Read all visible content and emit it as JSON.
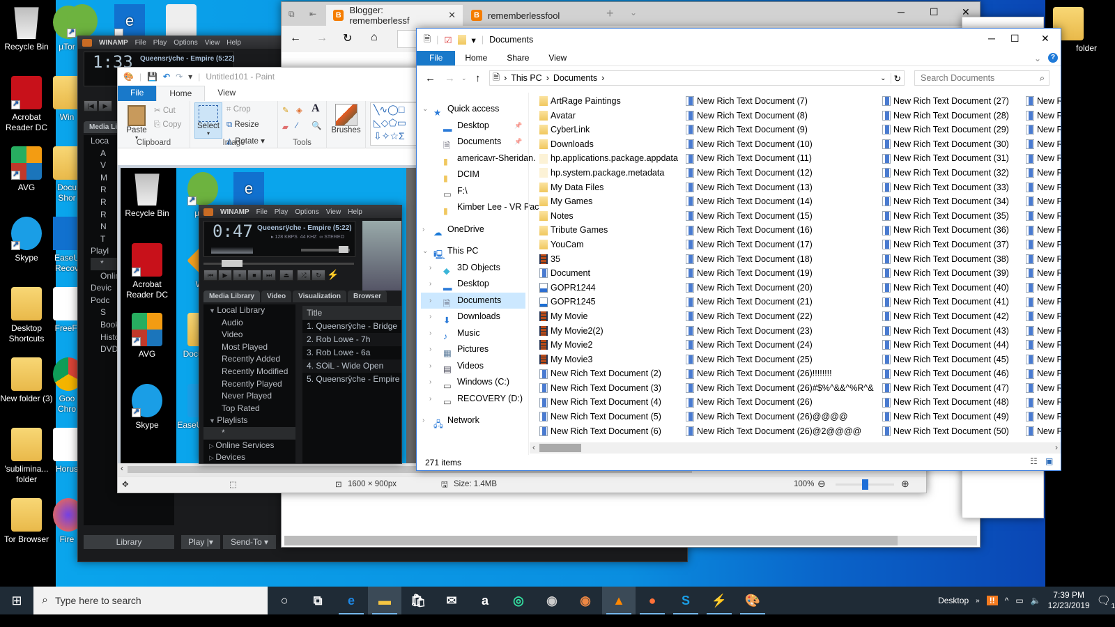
{
  "desktop": {
    "left_icons": [
      {
        "label": "Recycle Bin",
        "icon": "recycle-bin-icon"
      },
      {
        "label": "Acrobat Reader DC",
        "icon": "acrobat-icon"
      },
      {
        "label": "AVG",
        "icon": "avg-icon"
      },
      {
        "label": "Skype",
        "icon": "skype-icon"
      },
      {
        "label": "Desktop Shortcuts",
        "icon": "folder-icon"
      },
      {
        "label": "New folder (3)",
        "icon": "folder-icon"
      },
      {
        "label": "'sublimina... folder",
        "icon": "folder-icon"
      },
      {
        "label": "Tor Browser",
        "icon": "tor-icon"
      }
    ],
    "second_col_icons": [
      {
        "label": "µTor",
        "icon": "utorrent-icon"
      },
      {
        "label": "Win",
        "icon": "winamp-icon"
      },
      {
        "label": "Docu Shor",
        "icon": "folder-icon"
      },
      {
        "label": "EaseU Recov",
        "icon": "easeus-icon"
      },
      {
        "label": "FreeFi",
        "icon": "freefile-icon"
      },
      {
        "label": "Goo Chro",
        "icon": "chrome-icon"
      },
      {
        "label": "Horus",
        "icon": "pdf-icon"
      },
      {
        "label": "Fire",
        "icon": "firefox-icon"
      }
    ],
    "top_icons": [
      {
        "label": "",
        "icon": "edge-icon"
      },
      {
        "label": "",
        "icon": "gradient-icon"
      }
    ],
    "right_icons": [
      {
        "label": "folder",
        "icon": "folder-icon"
      }
    ]
  },
  "winamp_back": {
    "brand": "WINAMP",
    "menu": [
      "File",
      "Play",
      "Options",
      "View",
      "Help"
    ],
    "time": "1:33",
    "song": "Queensrÿche - Empire (5:22)",
    "tab": "Media Lib",
    "tree": [
      "Loca",
      "A",
      "V",
      "M",
      "R",
      "R",
      "R",
      "N",
      "T",
      "Playl",
      "*",
      "Onlin",
      "Devic",
      "Podc",
      "S",
      "Book",
      "Histo",
      "DVD"
    ],
    "footer": {
      "library": "Library",
      "play": "Play",
      "send_to": "Send-To"
    }
  },
  "winamp_front": {
    "brand": "WINAMP",
    "menu": [
      "File",
      "Play",
      "Options",
      "View",
      "Help"
    ],
    "time": "0:47",
    "song": "Queensrÿche - Empire (5:22)",
    "bitrate": "128 KBPS",
    "khz": "44 KHZ",
    "stereo": "STEREO",
    "tabs": [
      "Media Library",
      "Video",
      "Visualization",
      "Browser"
    ],
    "tree": [
      {
        "label": "Local Library",
        "type": "group"
      },
      {
        "label": "Audio",
        "type": "item"
      },
      {
        "label": "Video",
        "type": "item"
      },
      {
        "label": "Most Played",
        "type": "item"
      },
      {
        "label": "Recently Added",
        "type": "item"
      },
      {
        "label": "Recently Modified",
        "type": "item"
      },
      {
        "label": "Recently Played",
        "type": "item"
      },
      {
        "label": "Never Played",
        "type": "item"
      },
      {
        "label": "Top Rated",
        "type": "item"
      },
      {
        "label": "Playlists",
        "type": "group"
      },
      {
        "label": "*",
        "type": "item"
      },
      {
        "label": "Online Services",
        "type": "collapsed"
      },
      {
        "label": "Devices",
        "type": "collapsed"
      }
    ],
    "playlist_header": "Title",
    "playlist": [
      "1. Queensrÿche - Bridge",
      "2. Rob Lowe - 7h",
      "3. Rob Lowe - 6a",
      "4. SOiL - Wide Open",
      "5. Queensrÿche - Empire"
    ]
  },
  "paint": {
    "title": "Untitled101 - Paint",
    "tabs": [
      "File",
      "Home",
      "View"
    ],
    "clipboard": {
      "paste": "Paste",
      "cut": "Cut",
      "copy": "Copy",
      "label": "Clipboard"
    },
    "image": {
      "select": "Select",
      "crop": "Crop",
      "resize": "Resize",
      "rotate": "Rotate",
      "label": "Image"
    },
    "tools_label": "Tools",
    "brushes": "Brushes",
    "status": {
      "dimensions": "1600 × 900px",
      "size": "Size: 1.4MB",
      "zoom": "100%"
    },
    "zoom_percent": 50
  },
  "edge": {
    "tabs": [
      {
        "label": "Blogger: rememberlessf",
        "active": true
      },
      {
        "label": "rememberlessfool",
        "active": false
      }
    ]
  },
  "explorer": {
    "title": "Documents",
    "ribbon_tabs": [
      "File",
      "Home",
      "Share",
      "View"
    ],
    "breadcrumb": [
      "This PC",
      "Documents"
    ],
    "search_placeholder": "Search Documents",
    "nav": [
      {
        "label": "Quick access",
        "level": 0,
        "icon": "star-icon",
        "expanded": true
      },
      {
        "label": "Desktop",
        "level": 1,
        "icon": "desktop-icon",
        "pinned": true
      },
      {
        "label": "Documents",
        "level": 1,
        "icon": "documents-icon",
        "pinned": true
      },
      {
        "label": "americavr-Sheridan.",
        "level": 1,
        "icon": "folder-icon"
      },
      {
        "label": "DCIM",
        "level": 1,
        "icon": "folder-icon"
      },
      {
        "label": "F:\\",
        "level": 1,
        "icon": "drive-icon"
      },
      {
        "label": "Kimber Lee - VR Pac",
        "level": 1,
        "icon": "folder-icon"
      },
      {
        "label": "OneDrive",
        "level": 0,
        "icon": "onedrive-icon",
        "expanded": false
      },
      {
        "label": "This PC",
        "level": 0,
        "icon": "pc-icon",
        "expanded": true
      },
      {
        "label": "3D Objects",
        "level": 1,
        "icon": "3d-objects-icon"
      },
      {
        "label": "Desktop",
        "level": 1,
        "icon": "desktop-icon"
      },
      {
        "label": "Documents",
        "level": 1,
        "icon": "documents-icon",
        "selected": true
      },
      {
        "label": "Downloads",
        "level": 1,
        "icon": "downloads-icon"
      },
      {
        "label": "Music",
        "level": 1,
        "icon": "music-icon"
      },
      {
        "label": "Pictures",
        "level": 1,
        "icon": "pictures-icon"
      },
      {
        "label": "Videos",
        "level": 1,
        "icon": "videos-icon"
      },
      {
        "label": "Windows (C:)",
        "level": 1,
        "icon": "drive-icon"
      },
      {
        "label": "RECOVERY (D:)",
        "level": 1,
        "icon": "drive-icon"
      },
      {
        "label": "Network",
        "level": 0,
        "icon": "network-icon",
        "expanded": false
      }
    ],
    "columns": [
      [
        {
          "name": "ArtRage Paintings",
          "type": "folder"
        },
        {
          "name": "Avatar",
          "type": "folder"
        },
        {
          "name": "CyberLink",
          "type": "folder"
        },
        {
          "name": "Downloads",
          "type": "folder"
        },
        {
          "name": "hp.applications.package.appdata",
          "type": "pkg"
        },
        {
          "name": "hp.system.package.metadata",
          "type": "pkg"
        },
        {
          "name": "My Data Files",
          "type": "folder"
        },
        {
          "name": "My Games",
          "type": "folder"
        },
        {
          "name": "Notes",
          "type": "folder"
        },
        {
          "name": "Tribute Games",
          "type": "folder"
        },
        {
          "name": "YouCam",
          "type": "folder"
        },
        {
          "name": "35",
          "type": "vid"
        },
        {
          "name": "Document",
          "type": "doc"
        },
        {
          "name": "GOPR1244",
          "type": "img"
        },
        {
          "name": "GOPR1245",
          "type": "mov"
        },
        {
          "name": "My Movie",
          "type": "vid"
        },
        {
          "name": "My Movie2(2)",
          "type": "vid"
        },
        {
          "name": "My Movie2",
          "type": "vid"
        },
        {
          "name": "My Movie3",
          "type": "vid"
        },
        {
          "name": "New Rich Text Document (2)",
          "type": "doc"
        },
        {
          "name": "New Rich Text Document (3)",
          "type": "doc"
        },
        {
          "name": "New Rich Text Document (4)",
          "type": "doc"
        },
        {
          "name": "New Rich Text Document (5)",
          "type": "doc"
        },
        {
          "name": "New Rich Text Document (6)",
          "type": "doc"
        }
      ],
      [
        {
          "name": "New Rich Text Document (7)",
          "type": "doc"
        },
        {
          "name": "New Rich Text Document (8)",
          "type": "doc"
        },
        {
          "name": "New Rich Text Document (9)",
          "type": "doc"
        },
        {
          "name": "New Rich Text Document (10)",
          "type": "doc"
        },
        {
          "name": "New Rich Text Document (11)",
          "type": "doc"
        },
        {
          "name": "New Rich Text Document (12)",
          "type": "doc"
        },
        {
          "name": "New Rich Text Document (13)",
          "type": "doc"
        },
        {
          "name": "New Rich Text Document (14)",
          "type": "doc"
        },
        {
          "name": "New Rich Text Document (15)",
          "type": "doc"
        },
        {
          "name": "New Rich Text Document (16)",
          "type": "doc"
        },
        {
          "name": "New Rich Text Document (17)",
          "type": "doc"
        },
        {
          "name": "New Rich Text Document (18)",
          "type": "doc"
        },
        {
          "name": "New Rich Text Document (19)",
          "type": "doc"
        },
        {
          "name": "New Rich Text Document (20)",
          "type": "doc"
        },
        {
          "name": "New Rich Text Document (21)",
          "type": "doc"
        },
        {
          "name": "New Rich Text Document (22)",
          "type": "doc"
        },
        {
          "name": "New Rich Text Document (23)",
          "type": "doc"
        },
        {
          "name": "New Rich Text Document (24)",
          "type": "doc"
        },
        {
          "name": "New Rich Text Document (25)",
          "type": "doc"
        },
        {
          "name": "New Rich Text Document (26)!!!!!!!!",
          "type": "doc"
        },
        {
          "name": "New Rich Text Document (26)#$%^&&^%R^&",
          "type": "doc"
        },
        {
          "name": "New Rich Text Document (26)",
          "type": "doc"
        },
        {
          "name": "New Rich Text Document (26)@@@@",
          "type": "doc"
        },
        {
          "name": "New Rich Text Document (26)@2@@@@",
          "type": "doc"
        }
      ],
      [
        {
          "name": "New Rich Text Document (27)",
          "type": "doc"
        },
        {
          "name": "New Rich Text Document (28)",
          "type": "doc"
        },
        {
          "name": "New Rich Text Document (29)",
          "type": "doc"
        },
        {
          "name": "New Rich Text Document (30)",
          "type": "doc"
        },
        {
          "name": "New Rich Text Document (31)",
          "type": "doc"
        },
        {
          "name": "New Rich Text Document (32)",
          "type": "doc"
        },
        {
          "name": "New Rich Text Document (33)",
          "type": "doc"
        },
        {
          "name": "New Rich Text Document (34)",
          "type": "doc"
        },
        {
          "name": "New Rich Text Document (35)",
          "type": "doc"
        },
        {
          "name": "New Rich Text Document (36)",
          "type": "doc"
        },
        {
          "name": "New Rich Text Document (37)",
          "type": "doc"
        },
        {
          "name": "New Rich Text Document (38)",
          "type": "doc"
        },
        {
          "name": "New Rich Text Document (39)",
          "type": "doc"
        },
        {
          "name": "New Rich Text Document (40)",
          "type": "doc"
        },
        {
          "name": "New Rich Text Document (41)",
          "type": "doc"
        },
        {
          "name": "New Rich Text Document (42)",
          "type": "doc"
        },
        {
          "name": "New Rich Text Document (43)",
          "type": "doc"
        },
        {
          "name": "New Rich Text Document (44)",
          "type": "doc"
        },
        {
          "name": "New Rich Text Document (45)",
          "type": "doc"
        },
        {
          "name": "New Rich Text Document (46)",
          "type": "doc"
        },
        {
          "name": "New Rich Text Document (47)",
          "type": "doc"
        },
        {
          "name": "New Rich Text Document (48)",
          "type": "doc"
        },
        {
          "name": "New Rich Text Document (49)",
          "type": "doc"
        },
        {
          "name": "New Rich Text Document (50)",
          "type": "doc"
        }
      ],
      [
        {
          "name": "New Rich",
          "type": "doc"
        },
        {
          "name": "New Rich",
          "type": "doc"
        },
        {
          "name": "New Rich",
          "type": "doc"
        },
        {
          "name": "New Rich",
          "type": "doc"
        },
        {
          "name": "New Rich",
          "type": "doc"
        },
        {
          "name": "New Rich",
          "type": "doc"
        },
        {
          "name": "New Rich",
          "type": "doc"
        },
        {
          "name": "New Rich",
          "type": "doc"
        },
        {
          "name": "New Rich",
          "type": "doc"
        },
        {
          "name": "New Rich",
          "type": "doc"
        },
        {
          "name": "New Rich",
          "type": "doc"
        },
        {
          "name": "New Rich",
          "type": "doc"
        },
        {
          "name": "New Rich",
          "type": "doc"
        },
        {
          "name": "New Rich",
          "type": "doc"
        },
        {
          "name": "New Rich",
          "type": "doc"
        },
        {
          "name": "New Rich",
          "type": "doc"
        },
        {
          "name": "New Rich",
          "type": "doc"
        },
        {
          "name": "New Rich",
          "type": "doc"
        },
        {
          "name": "New Rich",
          "type": "doc"
        },
        {
          "name": "New Rich",
          "type": "doc"
        },
        {
          "name": "New Rich",
          "type": "doc"
        },
        {
          "name": "New Rich",
          "type": "doc"
        },
        {
          "name": "New Rich",
          "type": "doc"
        },
        {
          "name": "New Rich",
          "type": "doc"
        }
      ]
    ],
    "status": "271 items"
  },
  "taskbar": {
    "search_placeholder": "Type here to search",
    "apps": [
      "cortana-icon",
      "task-view-icon",
      "edge-icon",
      "file-explorer-icon",
      "store-icon",
      "mail-icon",
      "amazon-icon",
      "tripadvisor-icon",
      "webcam-icon",
      "youcam-icon",
      "vlc-icon",
      "firefox-icon",
      "skype-icon",
      "winamp-icon",
      "paint-icon"
    ],
    "desktop_label": "Desktop",
    "time": "7:39 PM",
    "date": "12/23/2019",
    "notifications": "1"
  }
}
